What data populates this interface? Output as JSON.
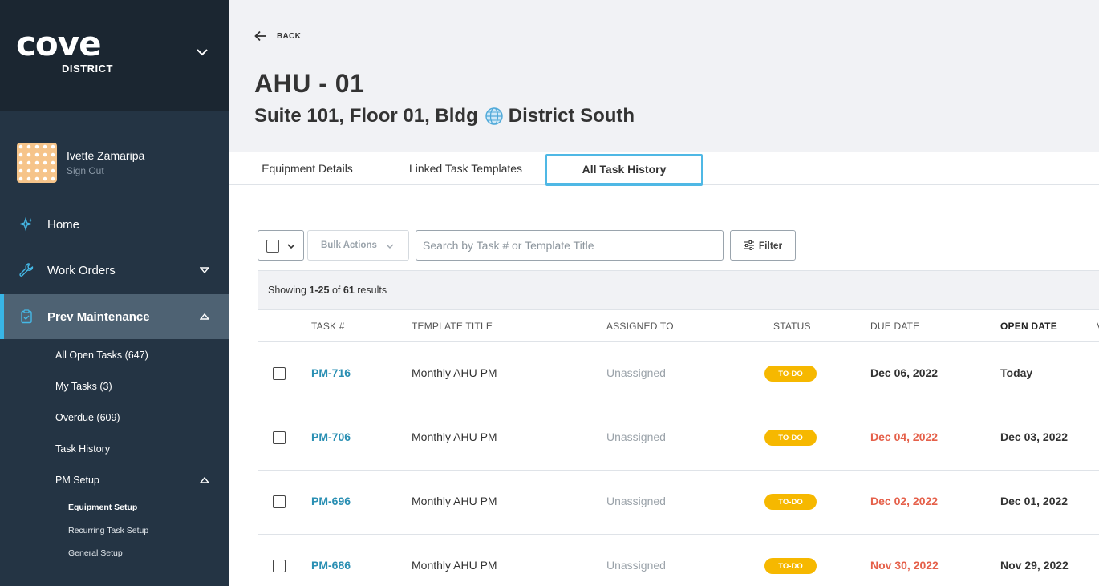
{
  "brand": {
    "logo_text": "cove",
    "logo_sub": "DISTRICT"
  },
  "user": {
    "name": "Ivette Zamaripa",
    "signout": "Sign Out"
  },
  "nav": {
    "home": "Home",
    "work_orders": "Work Orders",
    "prev_maintenance": "Prev Maintenance",
    "sub": {
      "all_open": "All Open Tasks (647)",
      "my_tasks": "My Tasks (3)",
      "overdue": "Overdue (609)",
      "task_history": "Task History",
      "pm_setup": "PM Setup",
      "equipment_setup": "Equipment Setup",
      "recurring_setup": "Recurring Task Setup",
      "general_setup": "General Setup"
    }
  },
  "header": {
    "back": "BACK",
    "title": "AHU - 01",
    "location_prefix": "Suite 101, Floor 01, Bldg",
    "location_suffix": "District South"
  },
  "tabs": [
    "Equipment Details",
    "Linked Task Templates",
    "All Task History"
  ],
  "toolbar": {
    "bulk_actions": "Bulk Actions",
    "search_placeholder": "Search by Task # or Template Title",
    "filter": "Filter"
  },
  "results": {
    "prefix": "Showing",
    "range": "1-25",
    "of": "of",
    "total": "61",
    "suffix": "results"
  },
  "columns": [
    "TASK #",
    "TEMPLATE TITLE",
    "ASSIGNED TO",
    "STATUS",
    "DUE DATE",
    "OPEN DATE",
    "V"
  ],
  "rows": [
    {
      "task": "PM-716",
      "template": "Monthly AHU PM",
      "assigned": "Unassigned",
      "status": "TO-DO",
      "due": "Dec 06, 2022",
      "open": "Today",
      "overdue": false
    },
    {
      "task": "PM-706",
      "template": "Monthly AHU PM",
      "assigned": "Unassigned",
      "status": "TO-DO",
      "due": "Dec 04, 2022",
      "open": "Dec 03, 2022",
      "overdue": true
    },
    {
      "task": "PM-696",
      "template": "Monthly AHU PM",
      "assigned": "Unassigned",
      "status": "TO-DO",
      "due": "Dec 02, 2022",
      "open": "Dec 01, 2022",
      "overdue": true
    },
    {
      "task": "PM-686",
      "template": "Monthly AHU PM",
      "assigned": "Unassigned",
      "status": "TO-DO",
      "due": "Nov 30, 2022",
      "open": "Nov 29, 2022",
      "overdue": true
    }
  ],
  "colors": {
    "accent": "#38b5e6",
    "sidebar": "#243444",
    "overdue": "#e5604a",
    "badge": "#f6b800",
    "link": "#2a8fb3"
  }
}
